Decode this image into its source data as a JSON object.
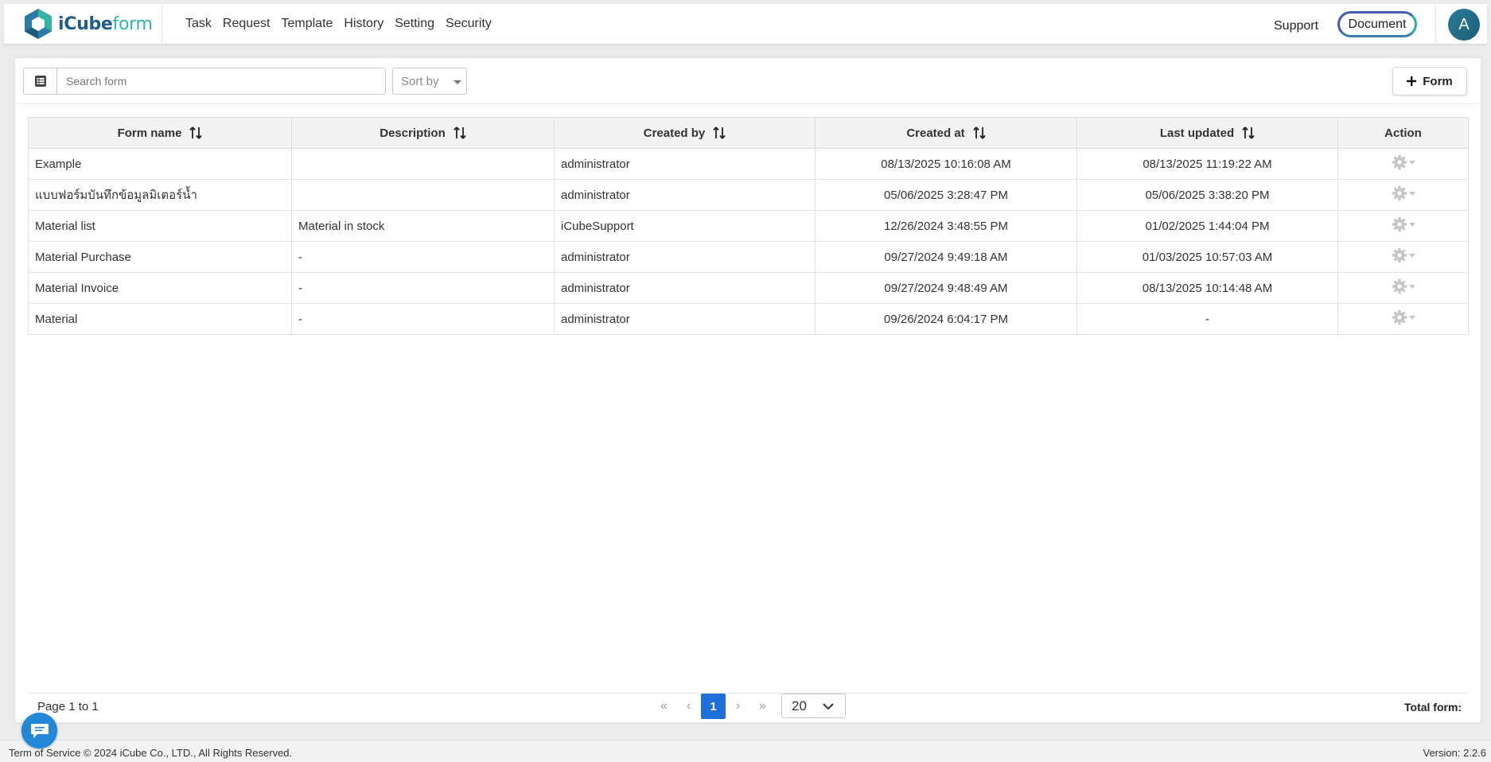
{
  "brand": {
    "part1": "iCube",
    "part2": "form"
  },
  "nav": {
    "items": [
      "Task",
      "Request",
      "Template",
      "History",
      "Setting",
      "Security"
    ]
  },
  "header": {
    "support_label": "Support",
    "document_label": "Document",
    "avatar_initial": "A"
  },
  "toolbar": {
    "search_placeholder": "Search form",
    "sort_label": "Sort by",
    "add_label": "Form"
  },
  "table": {
    "columns": [
      "Form name",
      "Description",
      "Created by",
      "Created at",
      "Last updated",
      "Action"
    ],
    "rows": [
      {
        "name": "Example",
        "description": "",
        "created_by": "administrator",
        "created_at": "08/13/2025 10:16:08 AM",
        "updated": "08/13/2025 11:19:22 AM"
      },
      {
        "name": "แบบฟอร์มบันทึกข้อมูลมิเตอร์น้ำ",
        "description": "",
        "created_by": "administrator",
        "created_at": "05/06/2025 3:28:47 PM",
        "updated": "05/06/2025 3:38:20 PM"
      },
      {
        "name": "Material list",
        "description": "Material in stock",
        "created_by": "iCubeSupport",
        "created_at": "12/26/2024 3:48:55 PM",
        "updated": "01/02/2025 1:44:04 PM"
      },
      {
        "name": "Material Purchase",
        "description": "-",
        "created_by": "administrator",
        "created_at": "09/27/2024 9:49:18 AM",
        "updated": "01/03/2025 10:57:03 AM"
      },
      {
        "name": "Material Invoice",
        "description": "-",
        "created_by": "administrator",
        "created_at": "09/27/2024 9:48:49 AM",
        "updated": "08/13/2025 10:14:48 AM"
      },
      {
        "name": "Material",
        "description": "-",
        "created_by": "administrator",
        "created_at": "09/26/2024 6:04:17 PM",
        "updated": "-"
      }
    ]
  },
  "pagination": {
    "info": "Page 1 to 1",
    "first": "«",
    "prev": "‹",
    "current_page": "1",
    "next": "›",
    "last": "»",
    "page_size": "20",
    "total_label": "Total form:"
  },
  "footer": {
    "left": "Term of Service © 2024 iCube Co., LTD., All Rights Reserved.",
    "version": "Version: 2.2.6"
  },
  "colors": {
    "accent": "#1e6fd9",
    "brand_blue": "#1f5e8c",
    "brand_teal": "#2eb6a6",
    "chat": "#2187d6"
  },
  "icons": [
    "hexagon-logo-icon",
    "list-icon",
    "plus-icon",
    "sort-icon",
    "gear-icon",
    "chevron-down-icon",
    "chat-icon"
  ]
}
